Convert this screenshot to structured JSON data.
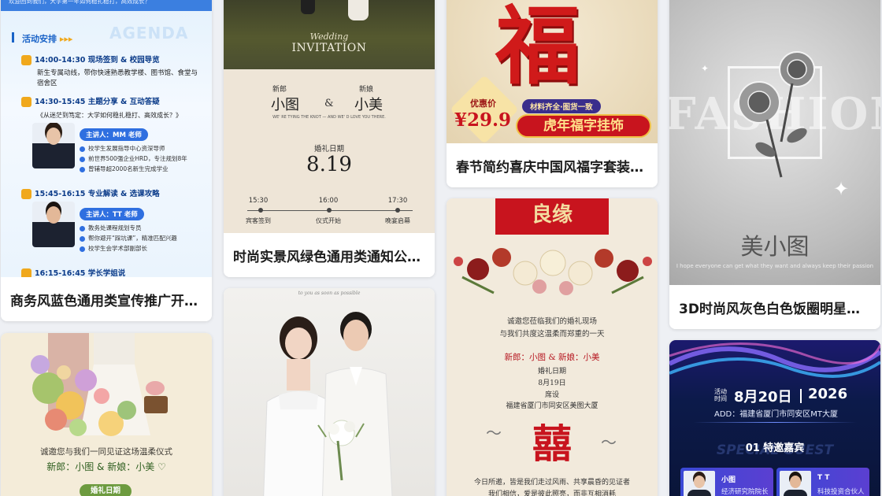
{
  "cards": [
    {
      "title": "商务风蓝色通用类宣传推广开…",
      "preview": {
        "top_strip": "欢迎回到我们，大学第一年如何稳扎稳打，高效成长？",
        "section_heading": "活动安排",
        "section_watermark": "AGENDA",
        "sessions": [
          {
            "time": "14:00-14:30",
            "name": "现场签到 & 校园导览",
            "desc": "新生专属动线，带你快速熟悉教学楼、图书馆、食堂与宿舍区"
          },
          {
            "time": "14:30-15:45",
            "name": "主题分享 & 互动答疑",
            "desc": "《从迷茫到笃定：大学如何稳扎稳打、高效成长？》",
            "speaker": "主讲人：MM 老师",
            "bullets": [
              "校学生发展指导中心资深导师",
              "前世界500强企业HRD，专注规划8年",
              "曾辅导超2000名新生完成学业"
            ]
          },
          {
            "time": "15:45-16:15",
            "name": "专业解读 & 选课攻略",
            "speaker": "主讲人：TT 老师",
            "bullets": [
              "教务处课程规划专员",
              "帮你避开“踩坑课”，精准匹配兴趣",
              "校学生会学术部副部长"
            ]
          },
          {
            "time": "16:15-16:45",
            "name": "学长学姐说"
          }
        ]
      }
    },
    {
      "title": "时尚实景风绿色通用类通知公…",
      "preview": {
        "script": "Wedding",
        "invitation": "INVITATION",
        "groom_role": "新郎",
        "bride_role": "新娘",
        "groom": "小图",
        "amp": "&",
        "bride": "小美",
        "tagline": "WE' RE TYING THE KNOT — AND WE' D LOVE YOU THERE.",
        "date_label": "婚礼日期",
        "date": "8.19",
        "timeline": [
          {
            "time": "15:30",
            "label": "宾客签到"
          },
          {
            "time": "16:00",
            "label": "仪式开始"
          },
          {
            "time": "17:30",
            "label": "晚宴启幕"
          }
        ]
      }
    },
    {
      "title": "春节简约喜庆中国风福字套装…",
      "preview": {
        "fu": "福",
        "price_label": "优惠价",
        "price": "¥29.9",
        "tagline": "材料齐全·图货一致",
        "product": "虎年福字挂饰"
      }
    },
    {
      "title": "3D时尚风灰色白色饭圈明星应…",
      "preview": {
        "fashion": "FASHION",
        "brand": "美小图",
        "subline": "I hope everyone can get what they want and always keep their passion"
      }
    },
    {
      "title": "",
      "preview": {
        "invite_line": "诚邀您与我们一同见证这场温柔仪式",
        "names": "新郎：小图 & 新娘：小美 ♡",
        "date_label": "婚礼日期"
      }
    },
    {
      "title": "",
      "preview": {
        "top_line": "to you as soon as possible"
      }
    },
    {
      "title": "",
      "preview": {
        "banner": "良缘",
        "lines": [
          "诚邀您莅临我们的婚礼现场",
          "与我们共度这温柔而郑重的一天"
        ],
        "couple": "新郎：小图 & 新娘：小美",
        "date_label": "婚礼日期",
        "date": "8月19日",
        "venue_label": "席设",
        "venue": "福建省厦门市同安区美图大厦",
        "xi": "囍",
        "closing": [
          "今日所邀，皆是我们走过风雨、共享晨昏的见证者",
          "我们相信，爱是彼此照亮，而非互相消耗"
        ]
      }
    },
    {
      "title": "",
      "preview": {
        "activity_label_1": "活动",
        "activity_label_2": "时间",
        "date": "8月20日",
        "year": "2026",
        "address": "ADD：福建省厦门市同安区MT大厦",
        "section": "01 特邀嘉宾",
        "section_watermark": "SPECIAL GUEST",
        "guests": [
          {
            "name": "小图",
            "role": "经济研究院院长"
          },
          {
            "name": "T T",
            "role": "科技投资合伙人"
          }
        ]
      }
    }
  ],
  "colors": {
    "page_bg": "#eef0f4",
    "accent_blue": "#2f6fe0",
    "festive_red": "#c8141e",
    "gold": "#f0a81c"
  }
}
